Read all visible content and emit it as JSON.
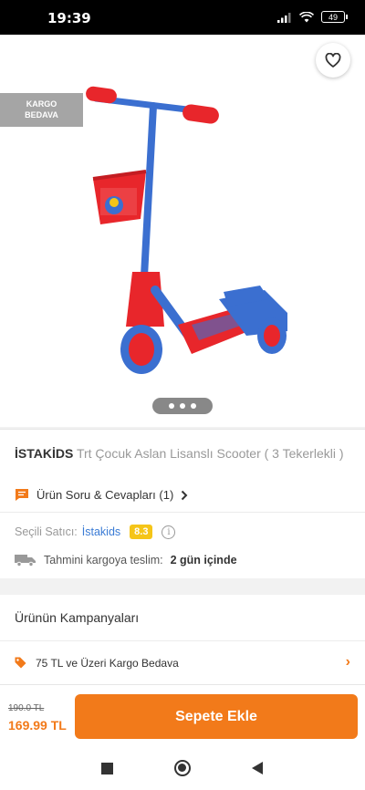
{
  "status_bar": {
    "time": "19:39",
    "battery": "49"
  },
  "hero": {
    "badge": [
      "KARGO",
      "BEDAVA"
    ],
    "carousel_pages": 3,
    "carousel_active": 0
  },
  "product": {
    "brand": "İSTAKİDS",
    "name": "Trt Çocuk Aslan Lisanslı Scooter ( 3 Tekerlekli )",
    "qa_label": "Ürün Soru & Cevapları (1)",
    "seller_label": "Seçili Satıcı:",
    "seller_name": "İstakids",
    "seller_rating": "8.3",
    "delivery_label": "Tahmini kargoya teslim:",
    "delivery_value": "2 gün içinde"
  },
  "campaigns": {
    "title": "Ürünün Kampanyaları",
    "items": [
      {
        "label": "75 TL ve Üzeri Kargo Bedava"
      }
    ]
  },
  "cart_bar": {
    "old_price": "190.0 TL",
    "new_price": "169.99 TL",
    "button_label": "Sepete Ekle"
  },
  "colors": {
    "accent": "#f27a1a",
    "seller_link": "#3a7bd5",
    "rating_badge": "#f5c518"
  },
  "icons": [
    "back-arrow-icon",
    "share-icon",
    "heart-icon",
    "chat-icon",
    "chevron-right-icon",
    "info-icon",
    "truck-icon",
    "tag-icon",
    "signal-icon",
    "wifi-icon",
    "battery-icon"
  ]
}
